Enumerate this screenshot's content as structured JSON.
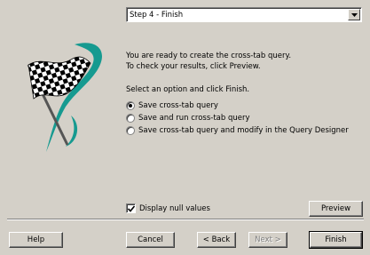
{
  "step_select": {
    "value": "Step 4 - Finish"
  },
  "intro": {
    "line1": "You are ready to create the cross-tab query.",
    "line2": "To check your results, click Preview."
  },
  "options": {
    "prompt": "Select an option and click Finish.",
    "items": [
      {
        "label": "Save cross-tab query",
        "checked": true
      },
      {
        "label": "Save and run cross-tab query",
        "checked": false
      },
      {
        "label": "Save cross-tab query and modify in the Query Designer",
        "checked": false
      }
    ]
  },
  "display_null": {
    "label": "Display null values",
    "checked": true
  },
  "buttons": {
    "preview": "Preview",
    "help": "Help",
    "cancel": "Cancel",
    "back": "< Back",
    "next": "Next >",
    "finish": "Finish"
  },
  "colors": {
    "dialog_bg": "#d4d0c8",
    "flag_swoosh": "#169a90"
  }
}
